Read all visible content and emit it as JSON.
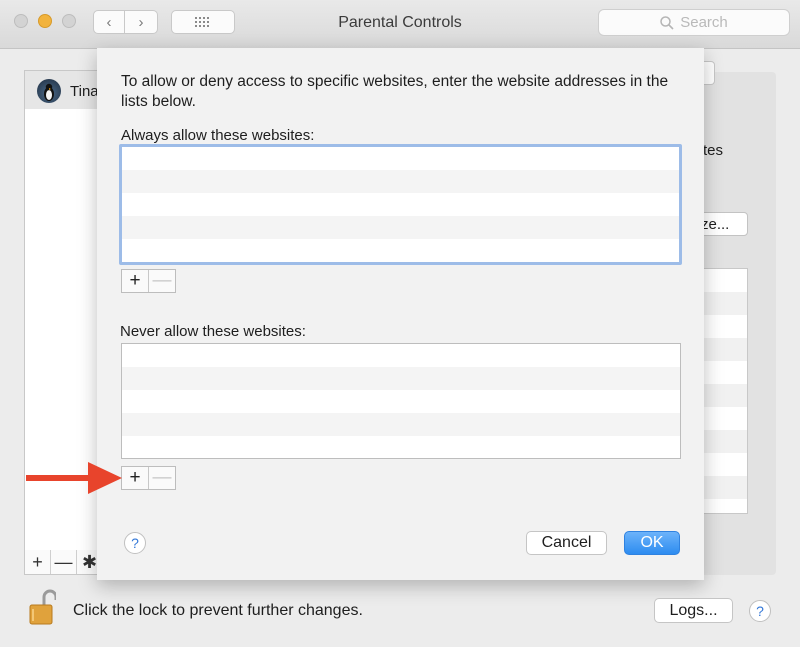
{
  "window": {
    "title": "Parental Controls"
  },
  "toolbar": {
    "search_placeholder": "Search"
  },
  "sidebar": {
    "users": [
      {
        "name": "Tina"
      }
    ]
  },
  "background": {
    "partial_text": "tes",
    "partial_button": "ze..."
  },
  "sheet": {
    "intro": "To allow or deny access to specific websites, enter the website addresses in the lists below.",
    "allow_label": "Always allow these websites:",
    "deny_label": "Never allow these websites:",
    "allow_list": [],
    "deny_list": [],
    "cancel_label": "Cancel",
    "ok_label": "OK"
  },
  "footer": {
    "lock_text": "Click the lock to prevent further changes.",
    "logs_label": "Logs..."
  },
  "icons": {
    "help": "?",
    "plus": "+",
    "minus": "—",
    "back": "‹",
    "forward": "›",
    "add_user": "+",
    "remove_user": "—",
    "gear": "✱"
  },
  "colors": {
    "accent": "#2d8cf0",
    "annotation_arrow": "#e8442c"
  }
}
